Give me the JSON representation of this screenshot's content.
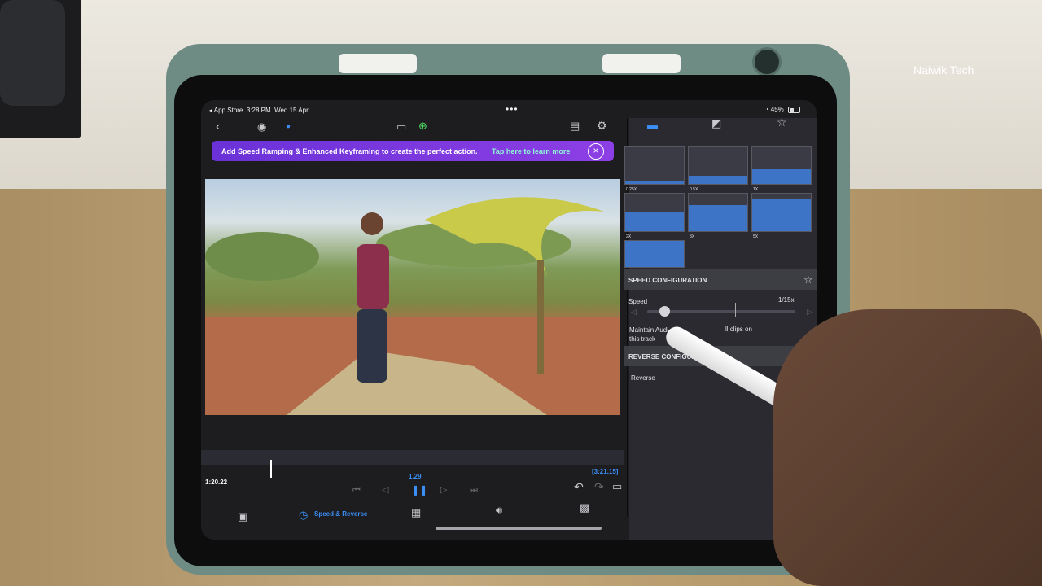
{
  "watermark": "Naiwik Tech",
  "status_bar": {
    "back_app": "◂ App Store",
    "time": "3:28 PM",
    "date": "Wed 15 Apr",
    "battery": "45%"
  },
  "banner": {
    "message": "Add Speed Ramping & Enhanced Keyframing to create the perfect action.",
    "link": "Tap here to learn more"
  },
  "playback": {
    "current_time": "1:20.22",
    "speed": "1.29",
    "duration": "[3:21.15]"
  },
  "toolbar": {
    "speed_reverse_label": "Speed & Reverse"
  },
  "speed_presets": [
    "0.25X",
    "0.5X",
    "1X",
    "2X",
    "3X",
    "5X"
  ],
  "speed_config": {
    "header": "SPEED CONFIGURATION",
    "speed_label": "Speed",
    "speed_value": "1/15x",
    "maintain_audio_left": "Maintain Audi",
    "maintain_audio_right": "ll clips on",
    "maintain_audio_line2": "this track"
  },
  "reverse_config": {
    "header": "REVERSE CONFIGURATION",
    "reverse_label": "Reverse"
  },
  "colors": {
    "accent": "#3a8ef6",
    "banner": "#7b3ae0",
    "banner_link": "#8ff7d6",
    "panel": "#2a2a30"
  },
  "icons": [
    "chevron-left-icon",
    "eye-icon",
    "aspect-icon",
    "add-icon",
    "clipboard-icon",
    "gear-icon",
    "layout-icon",
    "crop-icon",
    "star-icon",
    "skip-start-icon",
    "frame-back-icon",
    "pause-icon",
    "frame-forward-icon",
    "skip-end-icon",
    "undo-icon",
    "redo-icon",
    "fullscreen-icon",
    "media-icon",
    "speedometer-icon",
    "trim-icon",
    "volume-icon",
    "effects-icon",
    "close-icon"
  ]
}
